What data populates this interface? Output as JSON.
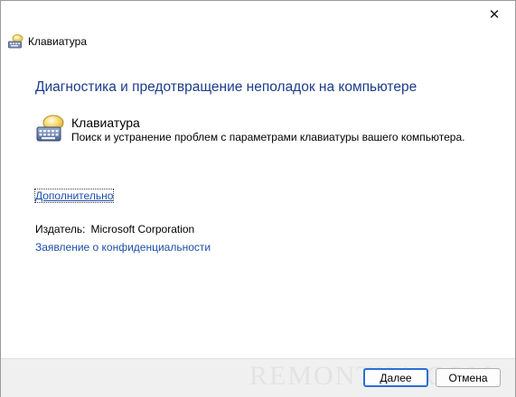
{
  "window": {
    "close_glyph": "✕"
  },
  "header": {
    "icon": "keyboard-icon",
    "title": "Клавиатура"
  },
  "main": {
    "heading": "Диагностика и предотвращение неполадок на компьютере",
    "troubleshooter": {
      "icon": "keyboard-icon",
      "title": "Клавиатура",
      "description": "Поиск и устранение проблем с параметрами клавиатуры вашего компьютера."
    },
    "advanced_link": "Дополнительно",
    "publisher_label": "Издатель:",
    "publisher_value": "Microsoft Corporation",
    "privacy_link": "Заявление о конфиденциальности"
  },
  "footer": {
    "watermark": "REMONTKA.COM",
    "next_label_first": "Д",
    "next_label_rest": "алее",
    "cancel_label": "Отмена"
  },
  "colors": {
    "heading": "#1c3c8c",
    "link": "#1c4fa8",
    "default_button_border": "#2b6fd6",
    "footer_bg": "#f0f0f0"
  }
}
